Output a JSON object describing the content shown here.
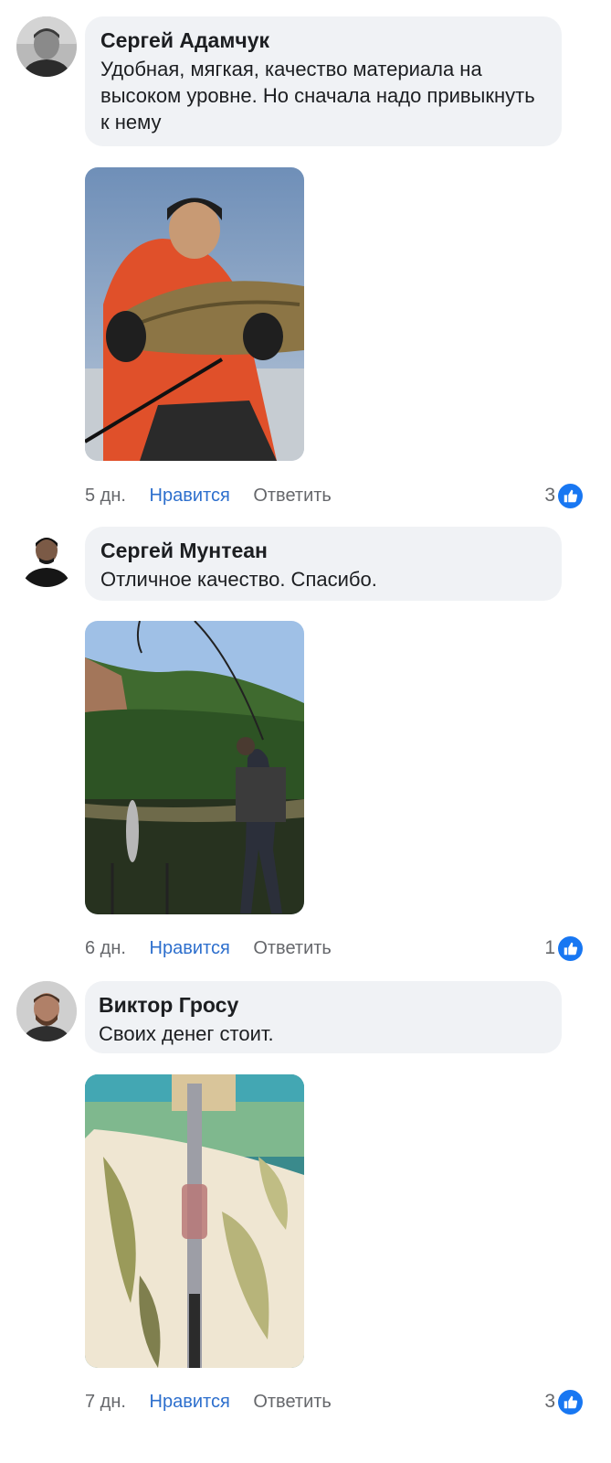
{
  "comments": [
    {
      "author": "Сергей Адамчук",
      "text": "Удобная, мягкая, качество материала на высоком уровне. Но сначала надо привыкнуть к нему",
      "time": "5 дн.",
      "like_label": "Нравится",
      "reply_label": "Ответить",
      "reactions_count": "3"
    },
    {
      "author": "Сергей Мунтеан",
      "text": "Отличное качество. Спасибо.",
      "time": "6 дн.",
      "like_label": "Нравится",
      "reply_label": "Ответить",
      "reactions_count": "1"
    },
    {
      "author": "Виктор Гросу",
      "text": "Своих денег стоит.",
      "time": "7 дн.",
      "like_label": "Нравится",
      "reply_label": "Ответить",
      "reactions_count": "3"
    }
  ],
  "icons": {
    "reaction": "like-thumb-icon"
  },
  "colors": {
    "bubble": "#f0f2f5",
    "like_link": "#2d6fcd",
    "muted": "#65676b",
    "reaction": "#1877f2"
  }
}
